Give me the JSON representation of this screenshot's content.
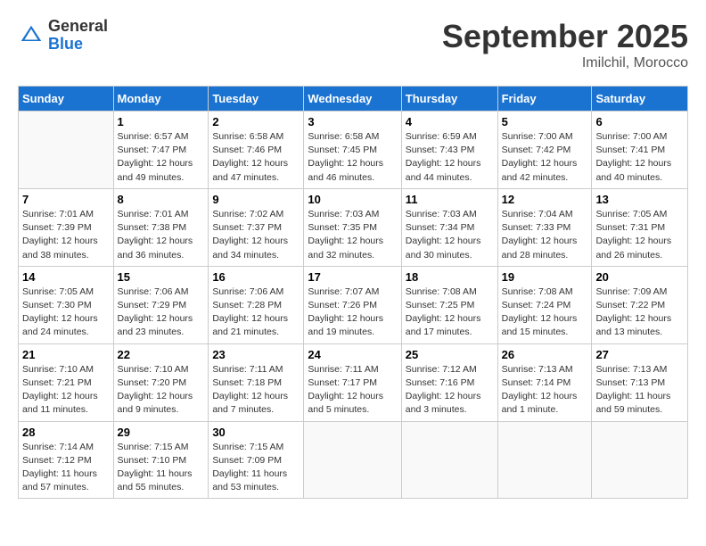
{
  "header": {
    "logo_general": "General",
    "logo_blue": "Blue",
    "month_title": "September 2025",
    "location": "Imilchil, Morocco"
  },
  "days_of_week": [
    "Sunday",
    "Monday",
    "Tuesday",
    "Wednesday",
    "Thursday",
    "Friday",
    "Saturday"
  ],
  "weeks": [
    [
      {
        "day": "",
        "sunrise": "",
        "sunset": "",
        "daylight": ""
      },
      {
        "day": "1",
        "sunrise": "Sunrise: 6:57 AM",
        "sunset": "Sunset: 7:47 PM",
        "daylight": "Daylight: 12 hours and 49 minutes."
      },
      {
        "day": "2",
        "sunrise": "Sunrise: 6:58 AM",
        "sunset": "Sunset: 7:46 PM",
        "daylight": "Daylight: 12 hours and 47 minutes."
      },
      {
        "day": "3",
        "sunrise": "Sunrise: 6:58 AM",
        "sunset": "Sunset: 7:45 PM",
        "daylight": "Daylight: 12 hours and 46 minutes."
      },
      {
        "day": "4",
        "sunrise": "Sunrise: 6:59 AM",
        "sunset": "Sunset: 7:43 PM",
        "daylight": "Daylight: 12 hours and 44 minutes."
      },
      {
        "day": "5",
        "sunrise": "Sunrise: 7:00 AM",
        "sunset": "Sunset: 7:42 PM",
        "daylight": "Daylight: 12 hours and 42 minutes."
      },
      {
        "day": "6",
        "sunrise": "Sunrise: 7:00 AM",
        "sunset": "Sunset: 7:41 PM",
        "daylight": "Daylight: 12 hours and 40 minutes."
      }
    ],
    [
      {
        "day": "7",
        "sunrise": "Sunrise: 7:01 AM",
        "sunset": "Sunset: 7:39 PM",
        "daylight": "Daylight: 12 hours and 38 minutes."
      },
      {
        "day": "8",
        "sunrise": "Sunrise: 7:01 AM",
        "sunset": "Sunset: 7:38 PM",
        "daylight": "Daylight: 12 hours and 36 minutes."
      },
      {
        "day": "9",
        "sunrise": "Sunrise: 7:02 AM",
        "sunset": "Sunset: 7:37 PM",
        "daylight": "Daylight: 12 hours and 34 minutes."
      },
      {
        "day": "10",
        "sunrise": "Sunrise: 7:03 AM",
        "sunset": "Sunset: 7:35 PM",
        "daylight": "Daylight: 12 hours and 32 minutes."
      },
      {
        "day": "11",
        "sunrise": "Sunrise: 7:03 AM",
        "sunset": "Sunset: 7:34 PM",
        "daylight": "Daylight: 12 hours and 30 minutes."
      },
      {
        "day": "12",
        "sunrise": "Sunrise: 7:04 AM",
        "sunset": "Sunset: 7:33 PM",
        "daylight": "Daylight: 12 hours and 28 minutes."
      },
      {
        "day": "13",
        "sunrise": "Sunrise: 7:05 AM",
        "sunset": "Sunset: 7:31 PM",
        "daylight": "Daylight: 12 hours and 26 minutes."
      }
    ],
    [
      {
        "day": "14",
        "sunrise": "Sunrise: 7:05 AM",
        "sunset": "Sunset: 7:30 PM",
        "daylight": "Daylight: 12 hours and 24 minutes."
      },
      {
        "day": "15",
        "sunrise": "Sunrise: 7:06 AM",
        "sunset": "Sunset: 7:29 PM",
        "daylight": "Daylight: 12 hours and 23 minutes."
      },
      {
        "day": "16",
        "sunrise": "Sunrise: 7:06 AM",
        "sunset": "Sunset: 7:28 PM",
        "daylight": "Daylight: 12 hours and 21 minutes."
      },
      {
        "day": "17",
        "sunrise": "Sunrise: 7:07 AM",
        "sunset": "Sunset: 7:26 PM",
        "daylight": "Daylight: 12 hours and 19 minutes."
      },
      {
        "day": "18",
        "sunrise": "Sunrise: 7:08 AM",
        "sunset": "Sunset: 7:25 PM",
        "daylight": "Daylight: 12 hours and 17 minutes."
      },
      {
        "day": "19",
        "sunrise": "Sunrise: 7:08 AM",
        "sunset": "Sunset: 7:24 PM",
        "daylight": "Daylight: 12 hours and 15 minutes."
      },
      {
        "day": "20",
        "sunrise": "Sunrise: 7:09 AM",
        "sunset": "Sunset: 7:22 PM",
        "daylight": "Daylight: 12 hours and 13 minutes."
      }
    ],
    [
      {
        "day": "21",
        "sunrise": "Sunrise: 7:10 AM",
        "sunset": "Sunset: 7:21 PM",
        "daylight": "Daylight: 12 hours and 11 minutes."
      },
      {
        "day": "22",
        "sunrise": "Sunrise: 7:10 AM",
        "sunset": "Sunset: 7:20 PM",
        "daylight": "Daylight: 12 hours and 9 minutes."
      },
      {
        "day": "23",
        "sunrise": "Sunrise: 7:11 AM",
        "sunset": "Sunset: 7:18 PM",
        "daylight": "Daylight: 12 hours and 7 minutes."
      },
      {
        "day": "24",
        "sunrise": "Sunrise: 7:11 AM",
        "sunset": "Sunset: 7:17 PM",
        "daylight": "Daylight: 12 hours and 5 minutes."
      },
      {
        "day": "25",
        "sunrise": "Sunrise: 7:12 AM",
        "sunset": "Sunset: 7:16 PM",
        "daylight": "Daylight: 12 hours and 3 minutes."
      },
      {
        "day": "26",
        "sunrise": "Sunrise: 7:13 AM",
        "sunset": "Sunset: 7:14 PM",
        "daylight": "Daylight: 12 hours and 1 minute."
      },
      {
        "day": "27",
        "sunrise": "Sunrise: 7:13 AM",
        "sunset": "Sunset: 7:13 PM",
        "daylight": "Daylight: 11 hours and 59 minutes."
      }
    ],
    [
      {
        "day": "28",
        "sunrise": "Sunrise: 7:14 AM",
        "sunset": "Sunset: 7:12 PM",
        "daylight": "Daylight: 11 hours and 57 minutes."
      },
      {
        "day": "29",
        "sunrise": "Sunrise: 7:15 AM",
        "sunset": "Sunset: 7:10 PM",
        "daylight": "Daylight: 11 hours and 55 minutes."
      },
      {
        "day": "30",
        "sunrise": "Sunrise: 7:15 AM",
        "sunset": "Sunset: 7:09 PM",
        "daylight": "Daylight: 11 hours and 53 minutes."
      },
      {
        "day": "",
        "sunrise": "",
        "sunset": "",
        "daylight": ""
      },
      {
        "day": "",
        "sunrise": "",
        "sunset": "",
        "daylight": ""
      },
      {
        "day": "",
        "sunrise": "",
        "sunset": "",
        "daylight": ""
      },
      {
        "day": "",
        "sunrise": "",
        "sunset": "",
        "daylight": ""
      }
    ]
  ]
}
